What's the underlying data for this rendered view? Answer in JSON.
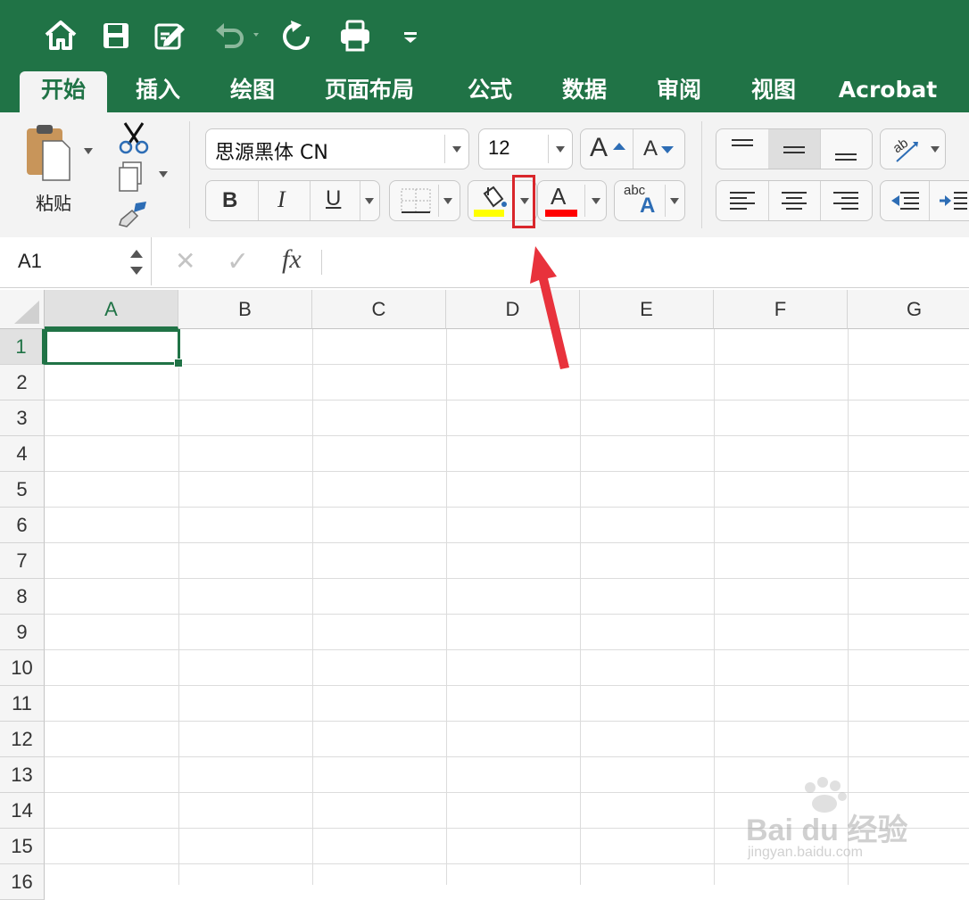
{
  "quick_access": {
    "icons": [
      "home-icon",
      "save-icon",
      "edit-document-icon",
      "undo-icon",
      "redo-icon",
      "print-icon",
      "customize-toolbar-icon"
    ]
  },
  "tabs": [
    {
      "label": "开始",
      "active": true
    },
    {
      "label": "插入"
    },
    {
      "label": "绘图"
    },
    {
      "label": "页面布局"
    },
    {
      "label": "公式"
    },
    {
      "label": "数据"
    },
    {
      "label": "审阅"
    },
    {
      "label": "视图"
    },
    {
      "label": "Acrobat"
    }
  ],
  "ribbon": {
    "paste_label": "粘贴",
    "font_name": "思源黑体 CN",
    "font_size": "12",
    "bold": "B",
    "italic": "I",
    "underline": "U",
    "font_color_glyph": "A",
    "phonetic_small": "abc",
    "phonetic_big": "A",
    "grow_font": "A",
    "shrink_font": "A",
    "fill_color": "#ffff00",
    "font_color": "#ff0000",
    "highlight_box_color": "#d9262b",
    "arrow_color": "#e8323c"
  },
  "formula_bar": {
    "name_box": "A1",
    "cancel_glyph": "✕",
    "enter_glyph": "✓",
    "fx_label": "fx"
  },
  "sheet": {
    "columns": [
      "A",
      "B",
      "C",
      "D",
      "E",
      "F",
      "G"
    ],
    "rows": [
      "1",
      "2",
      "3",
      "4",
      "5",
      "6",
      "7",
      "8",
      "9",
      "10",
      "11",
      "12",
      "13",
      "14",
      "15",
      "16"
    ],
    "selected_cell": "A1",
    "accent": "#207346"
  },
  "watermark": {
    "brand": "Bai du 经验",
    "url": "jingyan.baidu.com"
  }
}
